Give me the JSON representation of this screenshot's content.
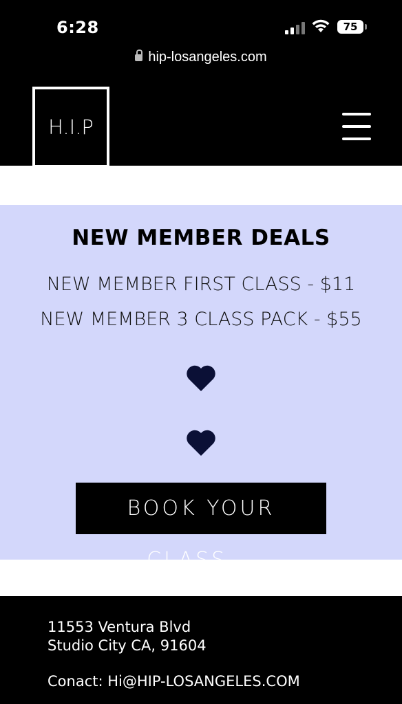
{
  "status_bar": {
    "time": "6:28",
    "battery": "75",
    "url": "hip-losangeles.com"
  },
  "header": {
    "logo": "H.I.P",
    "menu_icon": "hamburger-icon"
  },
  "deals": {
    "title": "NEW MEMBER DEALS",
    "lines": [
      "NEW MEMBER FIRST CLASS - $11",
      "NEW MEMBER 3 CLASS PACK  - $55"
    ],
    "icons": [
      "heart-icon",
      "heart-icon"
    ],
    "book_button": "BOOK YOUR CLASS...",
    "background": "#d3d7fb",
    "heart_color": "#0b1036"
  },
  "footer": {
    "address_line1": "11553 Ventura Blvd",
    "address_line2": "Studio City CA, 91604",
    "contact": "Conact: Hi@HIP-LOSANGELES.COM"
  }
}
